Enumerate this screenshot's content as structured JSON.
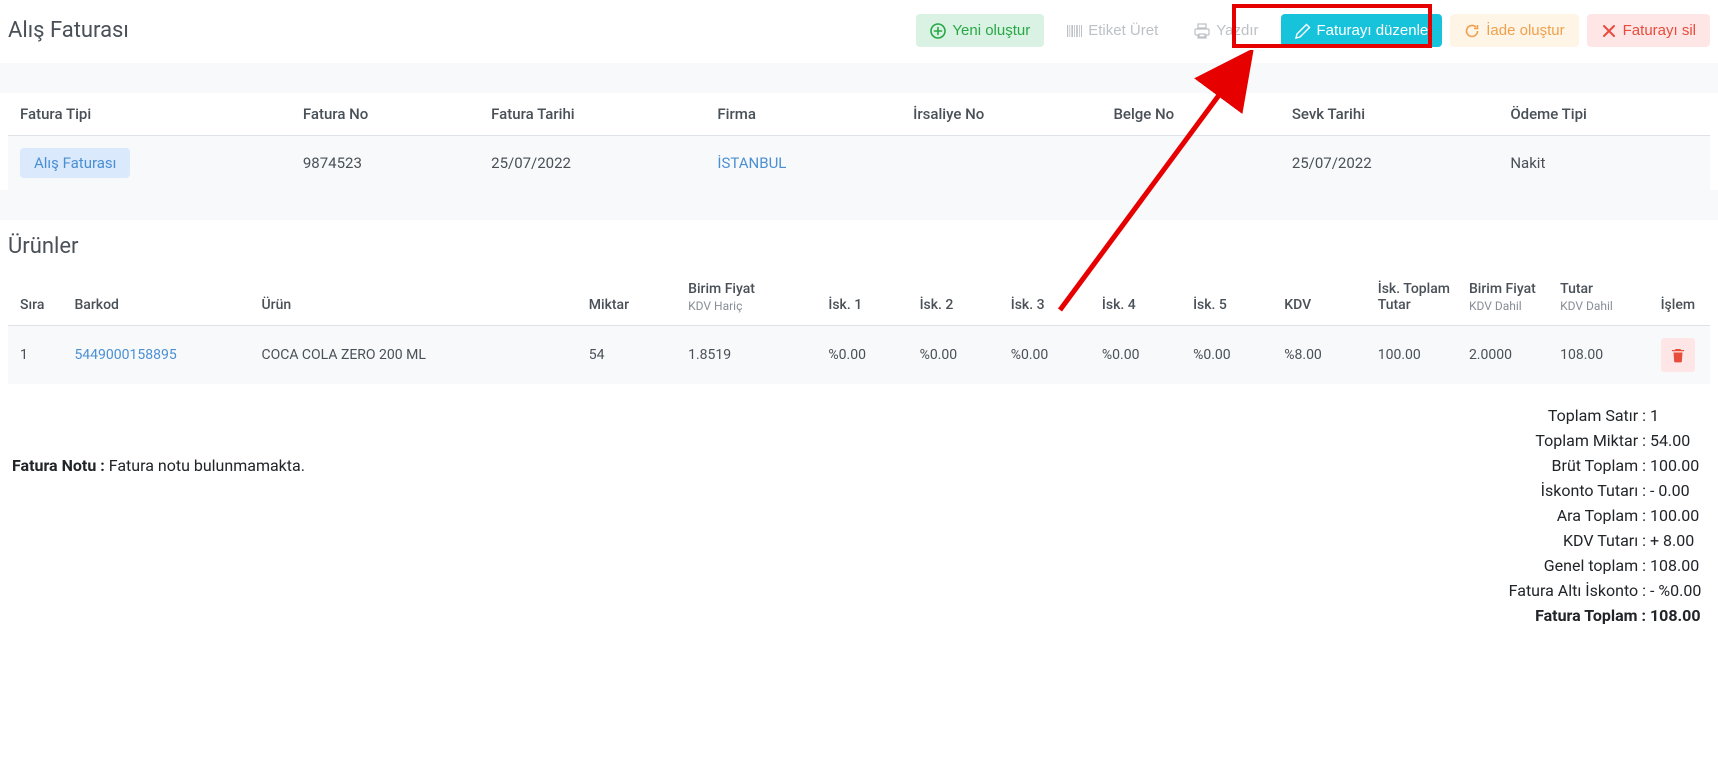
{
  "page_title": "Alış Faturası",
  "toolbar": {
    "create": "Yeni oluştur",
    "label": "Etiket Üret",
    "print": "Yazdır",
    "edit": "Faturayı düzenle",
    "return": "İade oluştur",
    "delete": "Faturayı sil"
  },
  "info_headers": {
    "type": "Fatura Tipi",
    "no": "Fatura No",
    "date": "Fatura Tarihi",
    "firm": "Firma",
    "dispatch_no": "İrsaliye No",
    "doc_no": "Belge No",
    "ship_date": "Sevk Tarihi",
    "pay_type": "Ödeme Tipi"
  },
  "info": {
    "type_badge": "Alış Faturası",
    "no": "9874523",
    "date": "25/07/2022",
    "firm": "İSTANBUL",
    "dispatch_no": "",
    "doc_no": "",
    "ship_date": "25/07/2022",
    "pay_type": "Nakit"
  },
  "products_title": "Ürünler",
  "product_headers": {
    "sira": "Sıra",
    "barkod": "Barkod",
    "urun": "Ürün",
    "miktar": "Miktar",
    "bf": "Birim Fiyat",
    "bf_sub": "KDV Hariç",
    "isk1": "İsk. 1",
    "isk2": "İsk. 2",
    "isk3": "İsk. 3",
    "isk4": "İsk. 4",
    "isk5": "İsk. 5",
    "kdv": "KDV",
    "itt": "İsk. Toplam Tutar",
    "bfd": "Birim Fiyat",
    "bfd_sub": "KDV Dahil",
    "tutar": "Tutar",
    "tutar_sub": "KDV Dahil",
    "islem": "İşlem"
  },
  "products": [
    {
      "sira": "1",
      "barkod": "5449000158895",
      "urun": "COCA COLA ZERO 200 ML",
      "miktar": "54",
      "bf": "1.8519",
      "isk1": "%0.00",
      "isk2": "%0.00",
      "isk3": "%0.00",
      "isk4": "%0.00",
      "isk5": "%0.00",
      "kdv": "%8.00",
      "itt": "100.00",
      "bfd": "2.0000",
      "tutar": "108.00"
    }
  ],
  "note_label": "Fatura Notu : ",
  "note_text": "Fatura notu bulunmamakta.",
  "totals": {
    "row_label": "Toplam Satır :",
    "row_val": "1",
    "qty_label": "Toplam Miktar :",
    "qty_val": "54.00",
    "gross_label": "Brüt Toplam :",
    "gross_val": "100.00",
    "disc_label": "İskonto Tutarı :",
    "disc_val": "- 0.00",
    "sub_label": "Ara Toplam :",
    "sub_val": "100.00",
    "vat_label": "KDV Tutarı :",
    "vat_val": "+ 8.00",
    "gen_label": "Genel toplam :",
    "gen_val": "108.00",
    "under_label": "Fatura Altı İskonto :",
    "under_val": "- %0.00",
    "grand_label": "Fatura Toplam :",
    "grand_val": "108.00"
  }
}
